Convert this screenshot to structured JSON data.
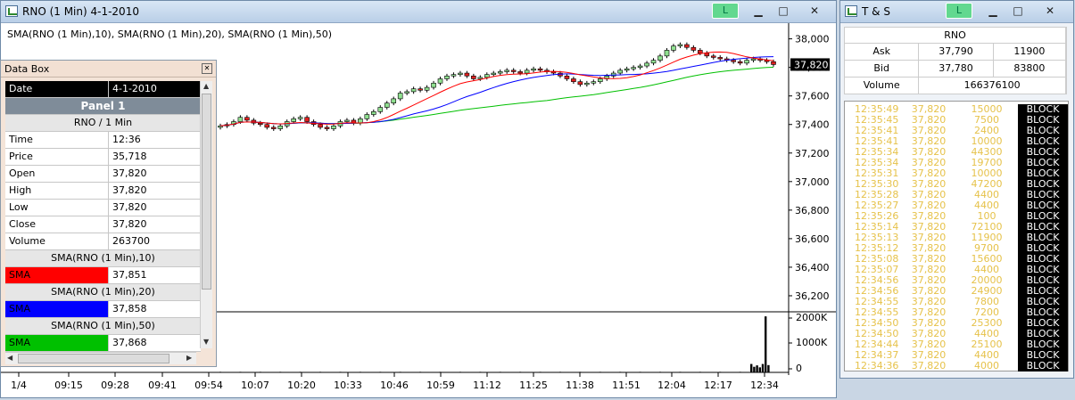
{
  "chart_window": {
    "title": "RNO (1 Min)  4-1-2010",
    "link_label": "L",
    "legend": "SMA(RNO (1 Min),10), SMA(RNO (1 Min),20), SMA(RNO (1 Min),50)",
    "last_price": "37,820",
    "price_axis": [
      "38,000",
      "37,800",
      "37,600",
      "37,400",
      "37,200",
      "37,000",
      "36,800",
      "36,600",
      "36,400",
      "36,200"
    ],
    "volume_axis": [
      "2000K",
      "1000K",
      "0"
    ],
    "time_axis": [
      "1/4",
      "09:15",
      "09:28",
      "09:41",
      "09:54",
      "10:07",
      "10:20",
      "10:33",
      "10:46",
      "10:59",
      "11:12",
      "11:25",
      "11:38",
      "11:51",
      "12:04",
      "12:17",
      "12:34"
    ]
  },
  "data_box": {
    "title": "Data Box",
    "date_label": "Date",
    "date_value": "4-1-2010",
    "panel_label": "Panel 1",
    "series_label": "RNO / 1 Min",
    "rows": [
      {
        "label": "Time",
        "value": "12:36"
      },
      {
        "label": "Price",
        "value": "35,718"
      },
      {
        "label": "Open",
        "value": "37,820"
      },
      {
        "label": "High",
        "value": "37,820"
      },
      {
        "label": "Low",
        "value": "37,820"
      },
      {
        "label": "Close",
        "value": "37,820"
      },
      {
        "label": "Volume",
        "value": "263700"
      }
    ],
    "sma": [
      {
        "header": "SMA(RNO (1 Min),10)",
        "label": "SMA",
        "value": "37,851",
        "color": "#ff0000"
      },
      {
        "header": "SMA(RNO (1 Min),20)",
        "label": "SMA",
        "value": "37,858",
        "color": "#0000ff"
      },
      {
        "header": "SMA(RNO (1 Min),50)",
        "label": "SMA",
        "value": "37,868",
        "color": "#00c000"
      }
    ]
  },
  "ts_window": {
    "title": "T & S",
    "link_label": "L",
    "symbol": "RNO",
    "ask_label": "Ask",
    "ask_price": "37,790",
    "ask_size": "11900",
    "bid_label": "Bid",
    "bid_price": "37,780",
    "bid_size": "83800",
    "volume_label": "Volume",
    "volume_value": "166376100",
    "prints": [
      {
        "time": "12:35:49",
        "price": "37,820",
        "size": "15000",
        "exch": "BLOCK"
      },
      {
        "time": "12:35:45",
        "price": "37,820",
        "size": "7500",
        "exch": "BLOCK"
      },
      {
        "time": "12:35:41",
        "price": "37,820",
        "size": "2400",
        "exch": "BLOCK"
      },
      {
        "time": "12:35:41",
        "price": "37,820",
        "size": "10000",
        "exch": "BLOCK"
      },
      {
        "time": "12:35:34",
        "price": "37,820",
        "size": "44300",
        "exch": "BLOCK"
      },
      {
        "time": "12:35:34",
        "price": "37,820",
        "size": "19700",
        "exch": "BLOCK"
      },
      {
        "time": "12:35:31",
        "price": "37,820",
        "size": "10000",
        "exch": "BLOCK"
      },
      {
        "time": "12:35:30",
        "price": "37,820",
        "size": "47200",
        "exch": "BLOCK"
      },
      {
        "time": "12:35:28",
        "price": "37,820",
        "size": "4400",
        "exch": "BLOCK"
      },
      {
        "time": "12:35:27",
        "price": "37,820",
        "size": "4400",
        "exch": "BLOCK"
      },
      {
        "time": "12:35:26",
        "price": "37,820",
        "size": "100",
        "exch": "BLOCK"
      },
      {
        "time": "12:35:14",
        "price": "37,820",
        "size": "72100",
        "exch": "BLOCK"
      },
      {
        "time": "12:35:13",
        "price": "37,820",
        "size": "11900",
        "exch": "BLOCK"
      },
      {
        "time": "12:35:12",
        "price": "37,820",
        "size": "9700",
        "exch": "BLOCK"
      },
      {
        "time": "12:35:08",
        "price": "37,820",
        "size": "15600",
        "exch": "BLOCK"
      },
      {
        "time": "12:35:07",
        "price": "37,820",
        "size": "4400",
        "exch": "BLOCK"
      },
      {
        "time": "12:34:56",
        "price": "37,820",
        "size": "20000",
        "exch": "BLOCK"
      },
      {
        "time": "12:34:56",
        "price": "37,820",
        "size": "24900",
        "exch": "BLOCK"
      },
      {
        "time": "12:34:55",
        "price": "37,820",
        "size": "7800",
        "exch": "BLOCK"
      },
      {
        "time": "12:34:55",
        "price": "37,820",
        "size": "7200",
        "exch": "BLOCK"
      },
      {
        "time": "12:34:50",
        "price": "37,820",
        "size": "25300",
        "exch": "BLOCK"
      },
      {
        "time": "12:34:50",
        "price": "37,820",
        "size": "4400",
        "exch": "BLOCK"
      },
      {
        "time": "12:34:44",
        "price": "37,820",
        "size": "25100",
        "exch": "BLOCK"
      },
      {
        "time": "12:34:37",
        "price": "37,820",
        "size": "4400",
        "exch": "BLOCK"
      },
      {
        "time": "12:34:36",
        "price": "37,820",
        "size": "4000",
        "exch": "BLOCK"
      }
    ]
  },
  "chart_data": {
    "type": "candlestick",
    "price_range": [
      36100,
      38060
    ],
    "volume_range": [
      0,
      2100000
    ],
    "time_ticks": [
      "1/4",
      "09:15",
      "09:28",
      "09:41",
      "09:54",
      "10:07",
      "10:20",
      "10:33",
      "10:46",
      "10:59",
      "11:12",
      "11:25",
      "11:38",
      "11:51",
      "12:04",
      "12:17",
      "12:34"
    ],
    "close": [
      37390,
      37400,
      37420,
      37450,
      37430,
      37410,
      37400,
      37380,
      37370,
      37390,
      37420,
      37440,
      37450,
      37420,
      37400,
      37380,
      37370,
      37390,
      37420,
      37430,
      37410,
      37440,
      37470,
      37490,
      37520,
      37550,
      37580,
      37620,
      37630,
      37650,
      37640,
      37660,
      37690,
      37720,
      37740,
      37750,
      37760,
      37740,
      37720,
      37730,
      37750,
      37760,
      37770,
      37780,
      37770,
      37760,
      37780,
      37790,
      37780,
      37770,
      37760,
      37740,
      37720,
      37700,
      37680,
      37690,
      37700,
      37720,
      37740,
      37760,
      37780,
      37790,
      37800,
      37810,
      37830,
      37850,
      37880,
      37920,
      37950,
      37960,
      37940,
      37920,
      37900,
      37880,
      37870,
      37860,
      37850,
      37840,
      37830,
      37850,
      37860,
      37850,
      37840,
      37820
    ],
    "sma_colors": {
      "sma10": "#ff0000",
      "sma20": "#0000ff",
      "sma50": "#00c000"
    },
    "volume_spikes": [
      300000,
      200000,
      250000,
      180000,
      300000,
      2000000,
      260000
    ]
  }
}
